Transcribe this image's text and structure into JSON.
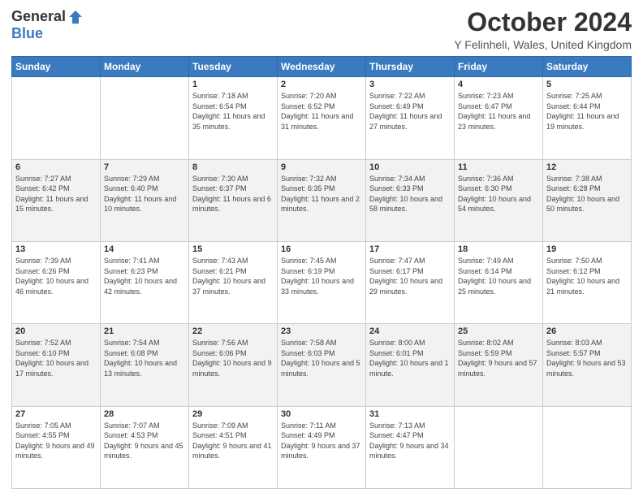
{
  "logo": {
    "general": "General",
    "blue": "Blue"
  },
  "header": {
    "title": "October 2024",
    "location": "Y Felinheli, Wales, United Kingdom"
  },
  "days": [
    "Sunday",
    "Monday",
    "Tuesday",
    "Wednesday",
    "Thursday",
    "Friday",
    "Saturday"
  ],
  "weeks": [
    [
      {
        "day": "",
        "info": ""
      },
      {
        "day": "",
        "info": ""
      },
      {
        "day": "1",
        "info": "Sunrise: 7:18 AM\nSunset: 6:54 PM\nDaylight: 11 hours and 35 minutes."
      },
      {
        "day": "2",
        "info": "Sunrise: 7:20 AM\nSunset: 6:52 PM\nDaylight: 11 hours and 31 minutes."
      },
      {
        "day": "3",
        "info": "Sunrise: 7:22 AM\nSunset: 6:49 PM\nDaylight: 11 hours and 27 minutes."
      },
      {
        "day": "4",
        "info": "Sunrise: 7:23 AM\nSunset: 6:47 PM\nDaylight: 11 hours and 23 minutes."
      },
      {
        "day": "5",
        "info": "Sunrise: 7:25 AM\nSunset: 6:44 PM\nDaylight: 11 hours and 19 minutes."
      }
    ],
    [
      {
        "day": "6",
        "info": "Sunrise: 7:27 AM\nSunset: 6:42 PM\nDaylight: 11 hours and 15 minutes."
      },
      {
        "day": "7",
        "info": "Sunrise: 7:29 AM\nSunset: 6:40 PM\nDaylight: 11 hours and 10 minutes."
      },
      {
        "day": "8",
        "info": "Sunrise: 7:30 AM\nSunset: 6:37 PM\nDaylight: 11 hours and 6 minutes."
      },
      {
        "day": "9",
        "info": "Sunrise: 7:32 AM\nSunset: 6:35 PM\nDaylight: 11 hours and 2 minutes."
      },
      {
        "day": "10",
        "info": "Sunrise: 7:34 AM\nSunset: 6:33 PM\nDaylight: 10 hours and 58 minutes."
      },
      {
        "day": "11",
        "info": "Sunrise: 7:36 AM\nSunset: 6:30 PM\nDaylight: 10 hours and 54 minutes."
      },
      {
        "day": "12",
        "info": "Sunrise: 7:38 AM\nSunset: 6:28 PM\nDaylight: 10 hours and 50 minutes."
      }
    ],
    [
      {
        "day": "13",
        "info": "Sunrise: 7:39 AM\nSunset: 6:26 PM\nDaylight: 10 hours and 46 minutes."
      },
      {
        "day": "14",
        "info": "Sunrise: 7:41 AM\nSunset: 6:23 PM\nDaylight: 10 hours and 42 minutes."
      },
      {
        "day": "15",
        "info": "Sunrise: 7:43 AM\nSunset: 6:21 PM\nDaylight: 10 hours and 37 minutes."
      },
      {
        "day": "16",
        "info": "Sunrise: 7:45 AM\nSunset: 6:19 PM\nDaylight: 10 hours and 33 minutes."
      },
      {
        "day": "17",
        "info": "Sunrise: 7:47 AM\nSunset: 6:17 PM\nDaylight: 10 hours and 29 minutes."
      },
      {
        "day": "18",
        "info": "Sunrise: 7:49 AM\nSunset: 6:14 PM\nDaylight: 10 hours and 25 minutes."
      },
      {
        "day": "19",
        "info": "Sunrise: 7:50 AM\nSunset: 6:12 PM\nDaylight: 10 hours and 21 minutes."
      }
    ],
    [
      {
        "day": "20",
        "info": "Sunrise: 7:52 AM\nSunset: 6:10 PM\nDaylight: 10 hours and 17 minutes."
      },
      {
        "day": "21",
        "info": "Sunrise: 7:54 AM\nSunset: 6:08 PM\nDaylight: 10 hours and 13 minutes."
      },
      {
        "day": "22",
        "info": "Sunrise: 7:56 AM\nSunset: 6:06 PM\nDaylight: 10 hours and 9 minutes."
      },
      {
        "day": "23",
        "info": "Sunrise: 7:58 AM\nSunset: 6:03 PM\nDaylight: 10 hours and 5 minutes."
      },
      {
        "day": "24",
        "info": "Sunrise: 8:00 AM\nSunset: 6:01 PM\nDaylight: 10 hours and 1 minute."
      },
      {
        "day": "25",
        "info": "Sunrise: 8:02 AM\nSunset: 5:59 PM\nDaylight: 9 hours and 57 minutes."
      },
      {
        "day": "26",
        "info": "Sunrise: 8:03 AM\nSunset: 5:57 PM\nDaylight: 9 hours and 53 minutes."
      }
    ],
    [
      {
        "day": "27",
        "info": "Sunrise: 7:05 AM\nSunset: 4:55 PM\nDaylight: 9 hours and 49 minutes."
      },
      {
        "day": "28",
        "info": "Sunrise: 7:07 AM\nSunset: 4:53 PM\nDaylight: 9 hours and 45 minutes."
      },
      {
        "day": "29",
        "info": "Sunrise: 7:09 AM\nSunset: 4:51 PM\nDaylight: 9 hours and 41 minutes."
      },
      {
        "day": "30",
        "info": "Sunrise: 7:11 AM\nSunset: 4:49 PM\nDaylight: 9 hours and 37 minutes."
      },
      {
        "day": "31",
        "info": "Sunrise: 7:13 AM\nSunset: 4:47 PM\nDaylight: 9 hours and 34 minutes."
      },
      {
        "day": "",
        "info": ""
      },
      {
        "day": "",
        "info": ""
      }
    ]
  ]
}
